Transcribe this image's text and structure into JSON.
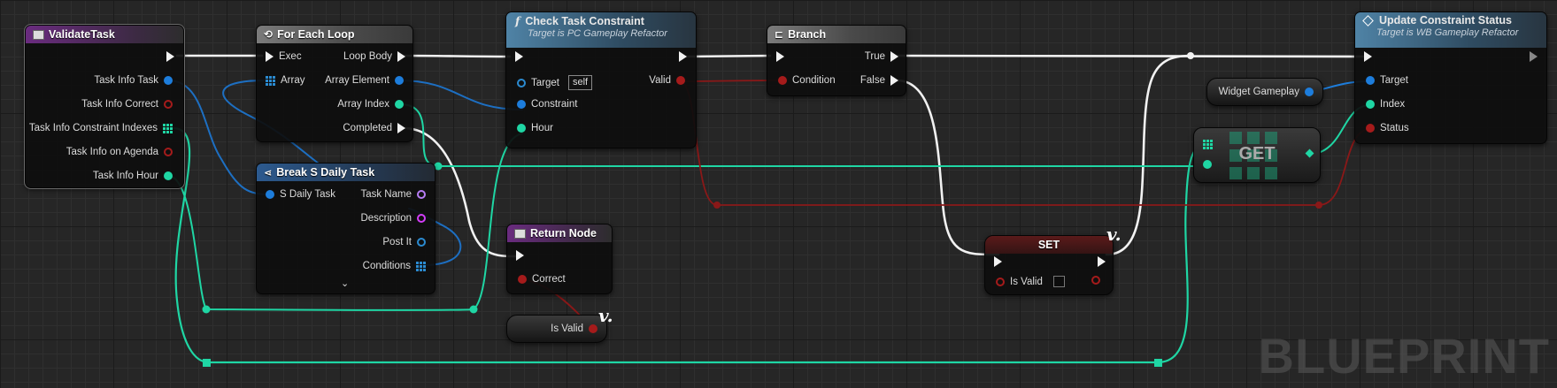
{
  "watermark": "BLUEPRINT",
  "colors": {
    "exec": "#f2f2f2",
    "object": "#1d7ddc",
    "bool": "#a51b1b",
    "int": "#1fd6a4",
    "struct": "#2b8bd1",
    "string": "#d33df7",
    "array_int": "#1fd6a4",
    "array_struct": "#2b8bd1",
    "name": "#b77df5"
  },
  "nodes": {
    "validate_task": {
      "title": "ValidateTask",
      "outputs": [
        "Task Info Task",
        "Task Info Correct",
        "Task Info Constraint Indexes",
        "Task Info on Agenda",
        "Task Info Hour"
      ]
    },
    "for_each": {
      "title": "For Each Loop",
      "exec_in": "Exec",
      "array_in": "Array",
      "loop_body": "Loop Body",
      "array_element": "Array Element",
      "array_index": "Array Index",
      "completed": "Completed"
    },
    "break_task": {
      "title": "Break S Daily Task",
      "input": "S Daily Task",
      "outputs": [
        "Task Name",
        "Description",
        "Post It",
        "Conditions"
      ]
    },
    "check_constraint": {
      "title": "Check Task Constraint",
      "subtitle": "Target is PC Gameplay Refactor",
      "target": "Target",
      "target_value": "self",
      "constraint": "Constraint",
      "hour": "Hour",
      "valid": "Valid"
    },
    "return_node": {
      "title": "Return Node",
      "correct": "Correct"
    },
    "is_valid_var": {
      "label": "Is Valid"
    },
    "branch": {
      "title": "Branch",
      "condition": "Condition",
      "true": "True",
      "false": "False"
    },
    "set_node": {
      "title": "SET",
      "is_valid": "Is Valid"
    },
    "widget_gameplay": {
      "label": "Widget Gameplay"
    },
    "get_node": {
      "label": "GET"
    },
    "update_status": {
      "title": "Update Constraint Status",
      "subtitle": "Target is WB Gameplay Refactor",
      "target": "Target",
      "index": "Index",
      "status": "Status"
    }
  }
}
